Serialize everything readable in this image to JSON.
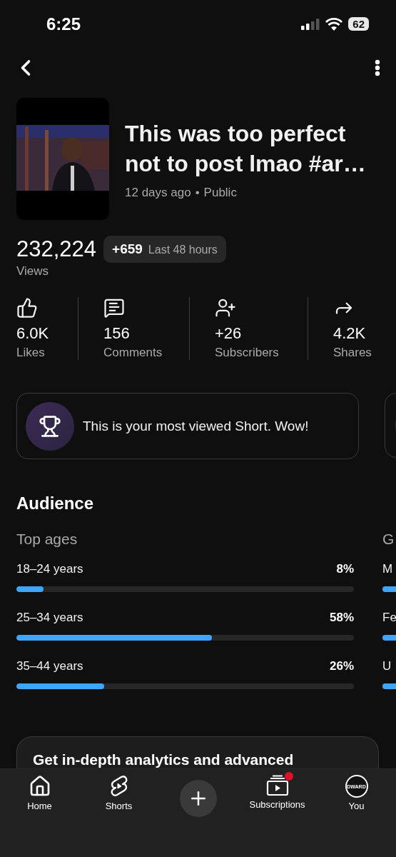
{
  "status_bar": {
    "time": "6:25",
    "battery": "62"
  },
  "video": {
    "title": "This was too perfect not to post lmao #ar…",
    "age": "12 days ago",
    "separator": "•",
    "visibility": "Public"
  },
  "views": {
    "value": "232,224",
    "delta": "+659",
    "delta_period": "Last 48 hours",
    "label": "Views"
  },
  "stats": [
    {
      "kind": "likes",
      "value": "6.0K",
      "label": "Likes"
    },
    {
      "kind": "comments",
      "value": "156",
      "label": "Comments"
    },
    {
      "kind": "subscribers",
      "value": "+26",
      "label": "Subscribers"
    },
    {
      "kind": "shares",
      "value": "4.2K",
      "label": "Shares"
    }
  ],
  "insight": {
    "text": "This is your most viewed Short. Wow!"
  },
  "audience": {
    "title": "Audience",
    "top_ages": {
      "title": "Top ages",
      "rows": [
        {
          "label": "18–24 years",
          "value": "8%",
          "level": 0.08
        },
        {
          "label": "25–34 years",
          "value": "58%",
          "level": 0.58
        },
        {
          "label": "35–44 years",
          "value": "26%",
          "level": 0.26
        }
      ]
    },
    "column_2": {
      "title": "G",
      "rows": [
        {
          "label": "M"
        },
        {
          "label": "Fe"
        },
        {
          "label": "U"
        }
      ]
    }
  },
  "promo": {
    "title": "Get in-depth analytics and advanced"
  },
  "bottom_nav": [
    {
      "kind": "home",
      "label": "Home"
    },
    {
      "kind": "shorts",
      "label": "Shorts"
    },
    {
      "kind": "create"
    },
    {
      "kind": "subscriptions",
      "label": "Subscriptions",
      "badge": true
    },
    {
      "kind": "you",
      "label": "You",
      "avatar_text": "DWARD"
    }
  ]
}
